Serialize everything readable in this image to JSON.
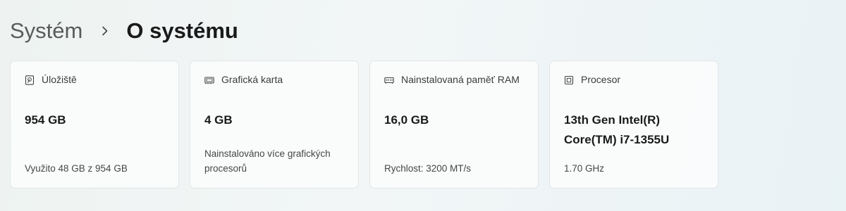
{
  "breadcrumb": {
    "parent": "Systém",
    "separator_icon": "chevron-right-icon",
    "current": "O systému"
  },
  "cards": [
    {
      "icon": "storage-icon",
      "label": "Úložiště",
      "value": "954 GB",
      "sub": "Využito 48 GB z 954 GB"
    },
    {
      "icon": "graphics-card-icon",
      "label": "Grafická karta",
      "value": "4 GB",
      "sub": "Nainstalováno více grafických procesorů"
    },
    {
      "icon": "memory-icon",
      "label": "Nainstalovaná paměť RAM",
      "value": "16,0 GB",
      "sub": "Rychlost: 3200 MT/s"
    },
    {
      "icon": "processor-icon",
      "label": "Procesor",
      "value": "13th Gen Intel(R) Core(TM) i7-1355U",
      "sub": "1.70 GHz"
    }
  ]
}
